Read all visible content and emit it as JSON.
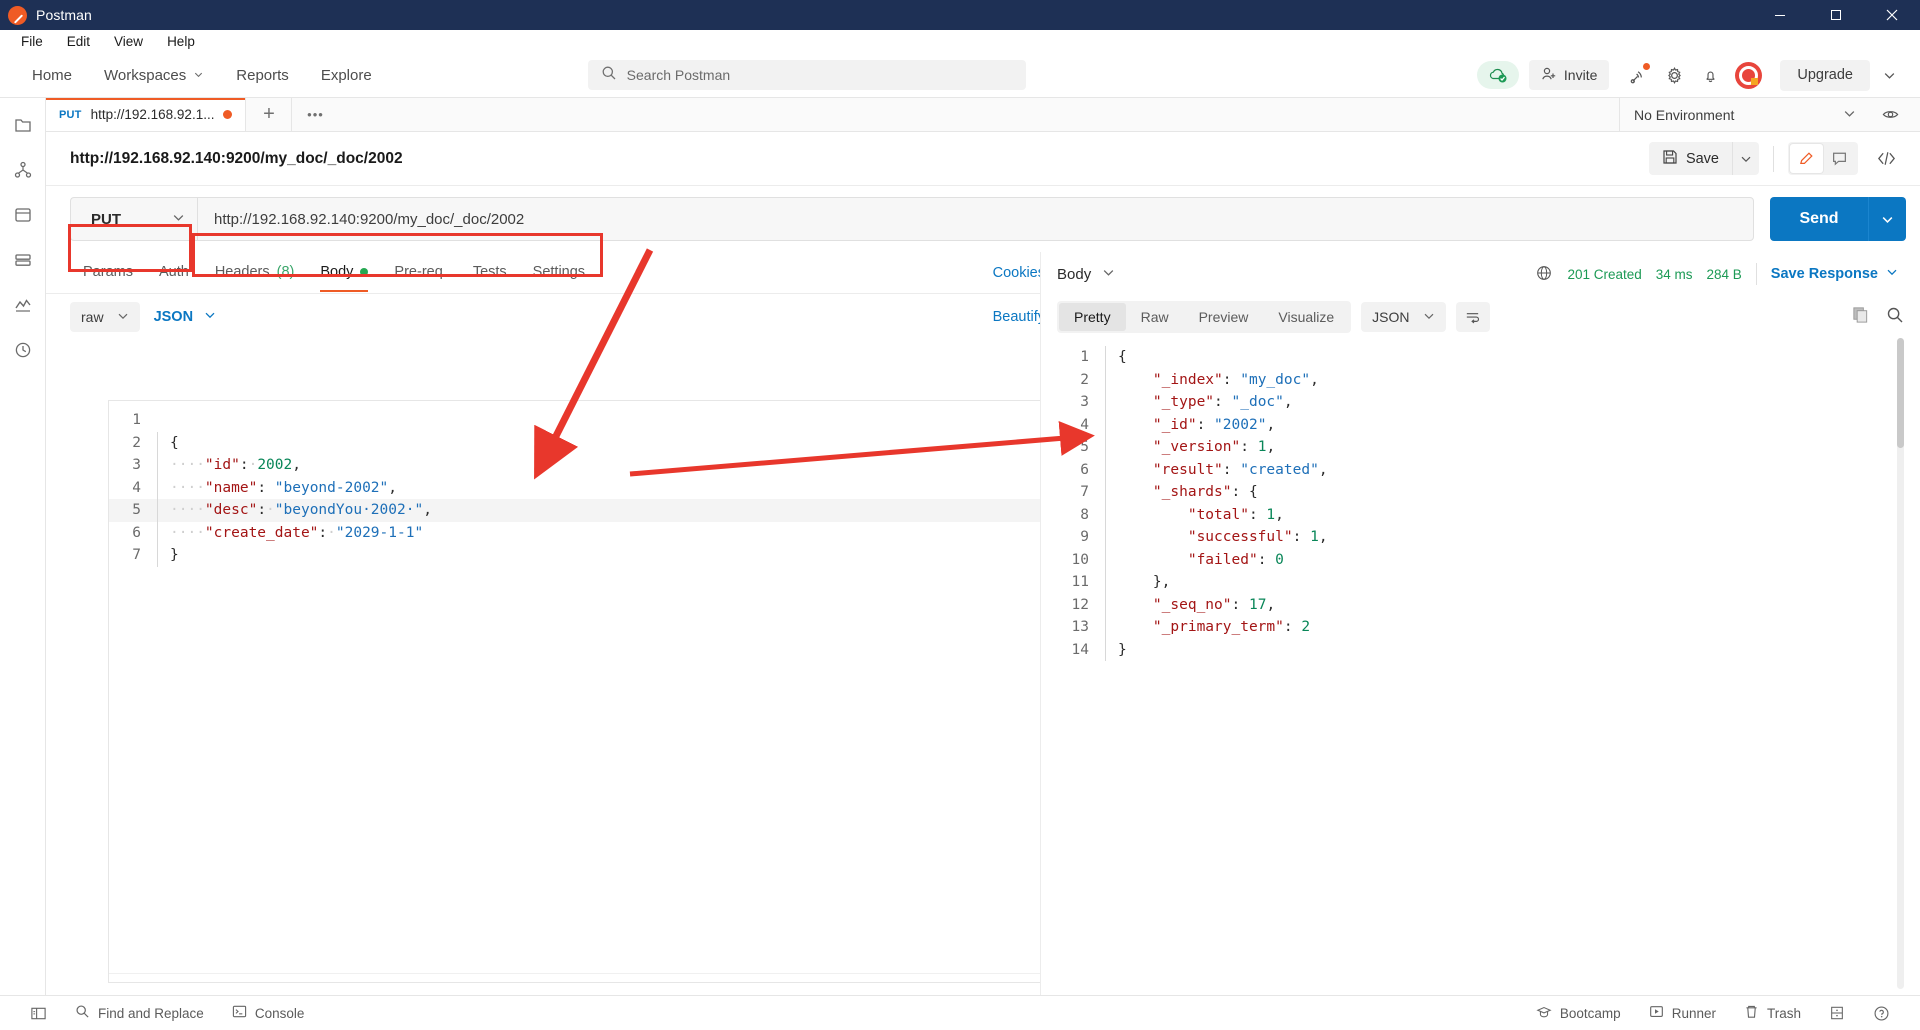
{
  "window": {
    "title": "Postman",
    "logo_icon": "postman-logo-icon",
    "minimize_icon": "minimize-icon",
    "maximize_icon": "maximize-icon",
    "close_icon": "close-icon"
  },
  "menubar": {
    "items": [
      "File",
      "Edit",
      "View",
      "Help"
    ]
  },
  "header": {
    "nav": [
      {
        "label": "Home",
        "caret": false
      },
      {
        "label": "Workspaces",
        "caret": true
      },
      {
        "label": "Reports",
        "caret": false
      },
      {
        "label": "Explore",
        "caret": false
      }
    ],
    "search": {
      "placeholder": "Search Postman",
      "icon": "search-icon"
    },
    "cloud_icon": "cloud-sync-ok-icon",
    "invite": {
      "label": "Invite",
      "icon": "invite-user-icon"
    },
    "icons": [
      "broadcast-icon",
      "gear-icon",
      "bell-icon"
    ],
    "avatar": "user-avatar",
    "upgrade": {
      "label": "Upgrade",
      "caret_icon": "chevron-down-icon"
    }
  },
  "rail": {
    "items": [
      "collections-icon",
      "apis-icon",
      "environments-icon",
      "mock-servers-icon",
      "monitors-icon",
      "history-icon"
    ]
  },
  "tabstrip": {
    "tab": {
      "method": "PUT",
      "name": "http://192.168.92.1...",
      "unsaved": true
    },
    "new_tab_icon": "plus-icon",
    "more_icon": "ellipsis-icon",
    "environment": {
      "value": "No Environment",
      "caret_icon": "chevron-down-icon"
    },
    "eye_icon": "eye-icon"
  },
  "request": {
    "title": "http://192.168.92.140:9200/my_doc/_doc/2002",
    "save": {
      "label": "Save",
      "icon": "save-disk-icon",
      "caret_icon": "chevron-down-icon"
    },
    "edit_icon": "pencil-icon",
    "comment_icon": "comment-icon",
    "code_icon": "code-brackets-icon",
    "method": "PUT",
    "method_caret_icon": "chevron-down-icon",
    "url": "http://192.168.92.140:9200/my_doc/_doc/2002",
    "send": {
      "label": "Send",
      "caret_icon": "chevron-down-icon"
    },
    "tabs": [
      {
        "label": "Params",
        "active": false
      },
      {
        "label": "Auth",
        "active": false
      },
      {
        "label": "Headers",
        "count": "(8)",
        "active": false
      },
      {
        "label": "Body",
        "active": true,
        "dot": true
      },
      {
        "label": "Pre-req.",
        "active": false
      },
      {
        "label": "Tests",
        "active": false
      },
      {
        "label": "Settings",
        "active": false
      }
    ],
    "cookies_link": "Cookies",
    "body_mode": "raw",
    "body_format": "JSON",
    "beautify": "Beautify",
    "body_lines": [
      {
        "n": "1",
        "tokens": []
      },
      {
        "n": "2",
        "tokens": [
          {
            "t": "{",
            "c": "p"
          }
        ]
      },
      {
        "n": "3",
        "tokens": [
          {
            "t": "····",
            "c": "ws"
          },
          {
            "t": "\"id\"",
            "c": "k"
          },
          {
            "t": ":",
            "c": "p"
          },
          {
            "t": "·",
            "c": "ws"
          },
          {
            "t": "2002",
            "c": "n"
          },
          {
            "t": ",",
            "c": "p"
          }
        ]
      },
      {
        "n": "4",
        "tokens": [
          {
            "t": "····",
            "c": "ws"
          },
          {
            "t": "\"name\"",
            "c": "k"
          },
          {
            "t": ":",
            "c": "p"
          },
          {
            "t": " ",
            "c": "ws"
          },
          {
            "t": "\"beyond-2002\"",
            "c": "s"
          },
          {
            "t": ",",
            "c": "p"
          }
        ]
      },
      {
        "n": "5",
        "highlight": true,
        "tokens": [
          {
            "t": "····",
            "c": "ws"
          },
          {
            "t": "\"desc\"",
            "c": "k"
          },
          {
            "t": ":",
            "c": "p"
          },
          {
            "t": "·",
            "c": "ws"
          },
          {
            "t": "\"beyondYou·2002·\"",
            "c": "s"
          },
          {
            "t": ",",
            "c": "p"
          }
        ]
      },
      {
        "n": "6",
        "tokens": [
          {
            "t": "····",
            "c": "ws"
          },
          {
            "t": "\"create_date\"",
            "c": "k"
          },
          {
            "t": ":",
            "c": "p"
          },
          {
            "t": "·",
            "c": "ws"
          },
          {
            "t": "\"2029-1-1\"",
            "c": "s"
          }
        ]
      },
      {
        "n": "7",
        "tokens": [
          {
            "t": "}",
            "c": "p"
          }
        ]
      }
    ]
  },
  "response": {
    "body_label": "Body",
    "body_caret_icon": "chevron-down-icon",
    "globe_icon": "globe-icon",
    "status": "201 Created",
    "time": "34 ms",
    "size": "284 B",
    "save_response": "Save Response",
    "save_response_caret_icon": "chevron-down-icon",
    "tabs": [
      {
        "label": "Pretty",
        "active": true
      },
      {
        "label": "Raw",
        "active": false
      },
      {
        "label": "Preview",
        "active": false
      },
      {
        "label": "Visualize",
        "active": false
      }
    ],
    "format": "JSON",
    "format_caret_icon": "chevron-down-icon",
    "wrap_icon": "word-wrap-icon",
    "copy_icon": "copy-icon",
    "search_icon": "search-icon",
    "body_lines": [
      {
        "n": "1",
        "tokens": [
          {
            "t": "{",
            "c": "p"
          }
        ]
      },
      {
        "n": "2",
        "tokens": [
          {
            "t": "    ",
            "c": "ws"
          },
          {
            "t": "\"_index\"",
            "c": "k"
          },
          {
            "t": ": ",
            "c": "p"
          },
          {
            "t": "\"my_doc\"",
            "c": "s"
          },
          {
            "t": ",",
            "c": "p"
          }
        ]
      },
      {
        "n": "3",
        "tokens": [
          {
            "t": "    ",
            "c": "ws"
          },
          {
            "t": "\"_type\"",
            "c": "k"
          },
          {
            "t": ": ",
            "c": "p"
          },
          {
            "t": "\"_doc\"",
            "c": "s"
          },
          {
            "t": ",",
            "c": "p"
          }
        ]
      },
      {
        "n": "4",
        "tokens": [
          {
            "t": "    ",
            "c": "ws"
          },
          {
            "t": "\"_id\"",
            "c": "k"
          },
          {
            "t": ": ",
            "c": "p"
          },
          {
            "t": "\"2002\"",
            "c": "s"
          },
          {
            "t": ",",
            "c": "p"
          }
        ]
      },
      {
        "n": "5",
        "tokens": [
          {
            "t": "    ",
            "c": "ws"
          },
          {
            "t": "\"_version\"",
            "c": "k"
          },
          {
            "t": ": ",
            "c": "p"
          },
          {
            "t": "1",
            "c": "n"
          },
          {
            "t": ",",
            "c": "p"
          }
        ]
      },
      {
        "n": "6",
        "tokens": [
          {
            "t": "    ",
            "c": "ws"
          },
          {
            "t": "\"result\"",
            "c": "k"
          },
          {
            "t": ": ",
            "c": "p"
          },
          {
            "t": "\"created\"",
            "c": "s"
          },
          {
            "t": ",",
            "c": "p"
          }
        ]
      },
      {
        "n": "7",
        "tokens": [
          {
            "t": "    ",
            "c": "ws"
          },
          {
            "t": "\"_shards\"",
            "c": "k"
          },
          {
            "t": ": {",
            "c": "p"
          }
        ]
      },
      {
        "n": "8",
        "tokens": [
          {
            "t": "        ",
            "c": "ws"
          },
          {
            "t": "\"total\"",
            "c": "k"
          },
          {
            "t": ": ",
            "c": "p"
          },
          {
            "t": "1",
            "c": "n"
          },
          {
            "t": ",",
            "c": "p"
          }
        ]
      },
      {
        "n": "9",
        "tokens": [
          {
            "t": "        ",
            "c": "ws"
          },
          {
            "t": "\"successful\"",
            "c": "k"
          },
          {
            "t": ": ",
            "c": "p"
          },
          {
            "t": "1",
            "c": "n"
          },
          {
            "t": ",",
            "c": "p"
          }
        ]
      },
      {
        "n": "10",
        "tokens": [
          {
            "t": "        ",
            "c": "ws"
          },
          {
            "t": "\"failed\"",
            "c": "k"
          },
          {
            "t": ": ",
            "c": "p"
          },
          {
            "t": "0",
            "c": "n"
          }
        ]
      },
      {
        "n": "11",
        "tokens": [
          {
            "t": "    ",
            "c": "ws"
          },
          {
            "t": "},",
            "c": "p"
          }
        ]
      },
      {
        "n": "12",
        "tokens": [
          {
            "t": "    ",
            "c": "ws"
          },
          {
            "t": "\"_seq_no\"",
            "c": "k"
          },
          {
            "t": ": ",
            "c": "p"
          },
          {
            "t": "17",
            "c": "n"
          },
          {
            "t": ",",
            "c": "p"
          }
        ]
      },
      {
        "n": "13",
        "tokens": [
          {
            "t": "    ",
            "c": "ws"
          },
          {
            "t": "\"_primary_term\"",
            "c": "k"
          },
          {
            "t": ": ",
            "c": "p"
          },
          {
            "t": "2",
            "c": "n"
          }
        ]
      },
      {
        "n": "14",
        "tokens": [
          {
            "t": "}",
            "c": "p"
          }
        ]
      }
    ]
  },
  "statusbar": {
    "sidebar_icon": "sidebar-toggle-icon",
    "left": [
      {
        "label": "Find and Replace",
        "icon": "search-icon"
      },
      {
        "label": "Console",
        "icon": "console-icon"
      }
    ],
    "right": [
      {
        "label": "Bootcamp",
        "icon": "bootcamp-cap-icon"
      },
      {
        "label": "Runner",
        "icon": "runner-play-icon"
      },
      {
        "label": "Trash",
        "icon": "trash-icon"
      }
    ],
    "layout_icon": "layout-icon",
    "help_icon": "help-circle-icon"
  },
  "annotations": {
    "accent_color": "#e8372c",
    "boxes": [
      "method-box-highlight",
      "url-box-highlight"
    ],
    "arrows": [
      "arrow-to-request-body",
      "arrow-to-response-body"
    ]
  }
}
